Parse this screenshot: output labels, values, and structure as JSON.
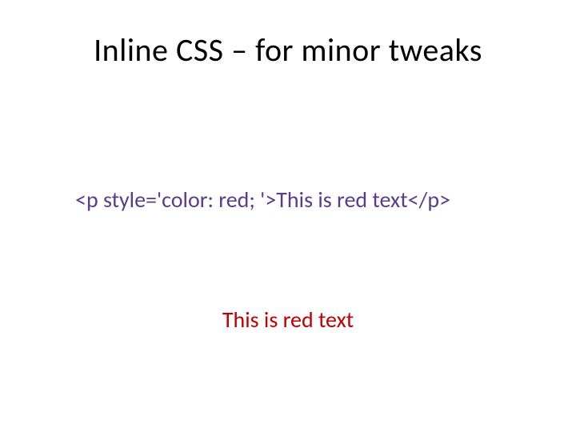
{
  "slide": {
    "title": "Inline CSS – for minor tweaks",
    "code_example": "<p style='color: red; '>This is red text</p>",
    "rendered_output": "This is red text"
  }
}
